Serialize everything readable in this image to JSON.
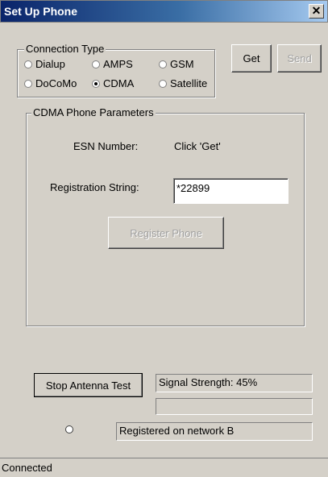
{
  "window": {
    "title": "Set Up Phone",
    "close_glyph": "✕"
  },
  "connection_type": {
    "label": "Connection Type",
    "options": [
      {
        "label": "Dialup",
        "selected": false
      },
      {
        "label": "AMPS",
        "selected": false
      },
      {
        "label": "GSM",
        "selected": false
      },
      {
        "label": "DoCoMo",
        "selected": false
      },
      {
        "label": "CDMA",
        "selected": true
      },
      {
        "label": "Satellite",
        "selected": false
      }
    ]
  },
  "buttons": {
    "get": "Get",
    "send": "Send"
  },
  "cdma_params": {
    "label": "CDMA Phone Parameters",
    "esn_label": "ESN Number:",
    "esn_value": "Click 'Get'",
    "registration_label": "Registration String:",
    "registration_value": "*22899",
    "register_button": "Register Phone"
  },
  "antenna": {
    "stop_button": "Stop Antenna Test",
    "signal_strength_text": "Signal Strength: 45%",
    "progress_fraction": 0,
    "network_status": "Registered on network B"
  },
  "status_bar": {
    "text": "Connected"
  }
}
